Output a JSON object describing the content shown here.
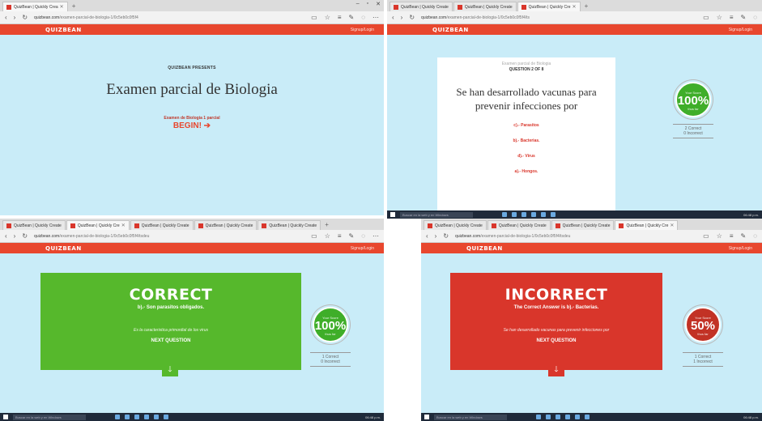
{
  "colors": {
    "brand": "#e8472e",
    "page_bg": "#c9ecf8",
    "correct": "#56b82c",
    "incorrect": "#d9362b",
    "score_green": "#3fae29",
    "score_red": "#c23225"
  },
  "browser": {
    "new_tab_symbol": "+",
    "window_controls": [
      "–",
      "▫",
      "✕"
    ],
    "nav_icons": [
      "back-icon",
      "forward-icon",
      "refresh-icon"
    ],
    "right_icons": [
      "reading-view-icon",
      "favorite-star-icon",
      "hub-icon",
      "note-icon",
      "share-icon",
      "more-icon"
    ]
  },
  "app": {
    "logo": "QUIZBEAN",
    "signup": "Signup/Login"
  },
  "panel1": {
    "tabs": [
      {
        "label": "QuizBean | Quickly Crea"
      }
    ],
    "url_domain": "quizbean.com",
    "url_rest": "/examen-parcial-de-biologia-1/0c5eb0c0f5f4",
    "presents": "QUIZBEAN PRESENTS",
    "title": "Examen parcial de Biologia",
    "subtitle": "Examen de Biologia 1 parcial",
    "begin": "BEGIN! ➔"
  },
  "panel2": {
    "tabs": [
      {
        "label": "QuizBean | Quickly Create"
      },
      {
        "label": "QuizBean | Quickly Create"
      },
      {
        "label": "QuizBean | Quickly Cre"
      }
    ],
    "url_domain": "quizbean.com",
    "url_rest": "/examen-parcial-de-biologia-1/0c5eb0c0f5f4/ts",
    "course": "Examen parcial de Biologia",
    "question_number": "QUESTION 2 OF 8",
    "question": "Se han desarrollado vacunas para prevenir infecciones por",
    "answers": [
      "c).- Parasitos",
      "b).- Bacterias.",
      "d).- Virus",
      "a).- Hongos."
    ],
    "score_label": "Your Score",
    "score": "100%",
    "score_sub": "thus far",
    "correct": "2 Correct",
    "incorrect": "0 Incorrect"
  },
  "panel3": {
    "tabs": [
      {
        "label": "QuizBean | Quickly Create"
      },
      {
        "label": "QuizBean | Quickly Cre"
      },
      {
        "label": "QuizBean | Quickly Create"
      },
      {
        "label": "QuizBean | Quickly Create"
      },
      {
        "label": "QuizBean | Quickly Create"
      }
    ],
    "url_domain": "quizbean.com",
    "url_rest": "/examen-parcial-de-biologia-1/0c5eb0c0f5f4/tsdeu",
    "result": "CORRECT",
    "answer": "b).- Son parasitos obligados.",
    "explanation": "Es la caracteristica primordial de los virus",
    "next": "NEXT QUESTION",
    "score_label": "Your Score",
    "score": "100%",
    "score_sub": "thus far",
    "correct": "1 Correct",
    "incorrect": "0 Incorrect"
  },
  "panel4": {
    "tabs": [
      {
        "label": "QuizBean | Quickly Create"
      },
      {
        "label": "QuizBean | Quickly Create"
      },
      {
        "label": "QuizBean | Quickly Create"
      },
      {
        "label": "QuizBean | Quickly Cre"
      }
    ],
    "url_domain": "quizbean.com",
    "url_rest": "/examen-parcial-de-biologia-1/0c5eb0c0f5f4/tsdeu",
    "result": "INCORRECT",
    "answer_prefix": "The Correct Answer is",
    "answer": "b).- Bacterias.",
    "explanation": "Se han desarrollado vacunas para prevenir infecciones por",
    "next": "NEXT QUESTION",
    "score_label": "Your Score",
    "score": "50%",
    "score_sub": "thus far",
    "correct": "1 Correct",
    "incorrect": "1 Incorrect"
  },
  "taskbar": {
    "search": "Buscar en la web y en Windows",
    "tray": "06:48 p.m."
  }
}
